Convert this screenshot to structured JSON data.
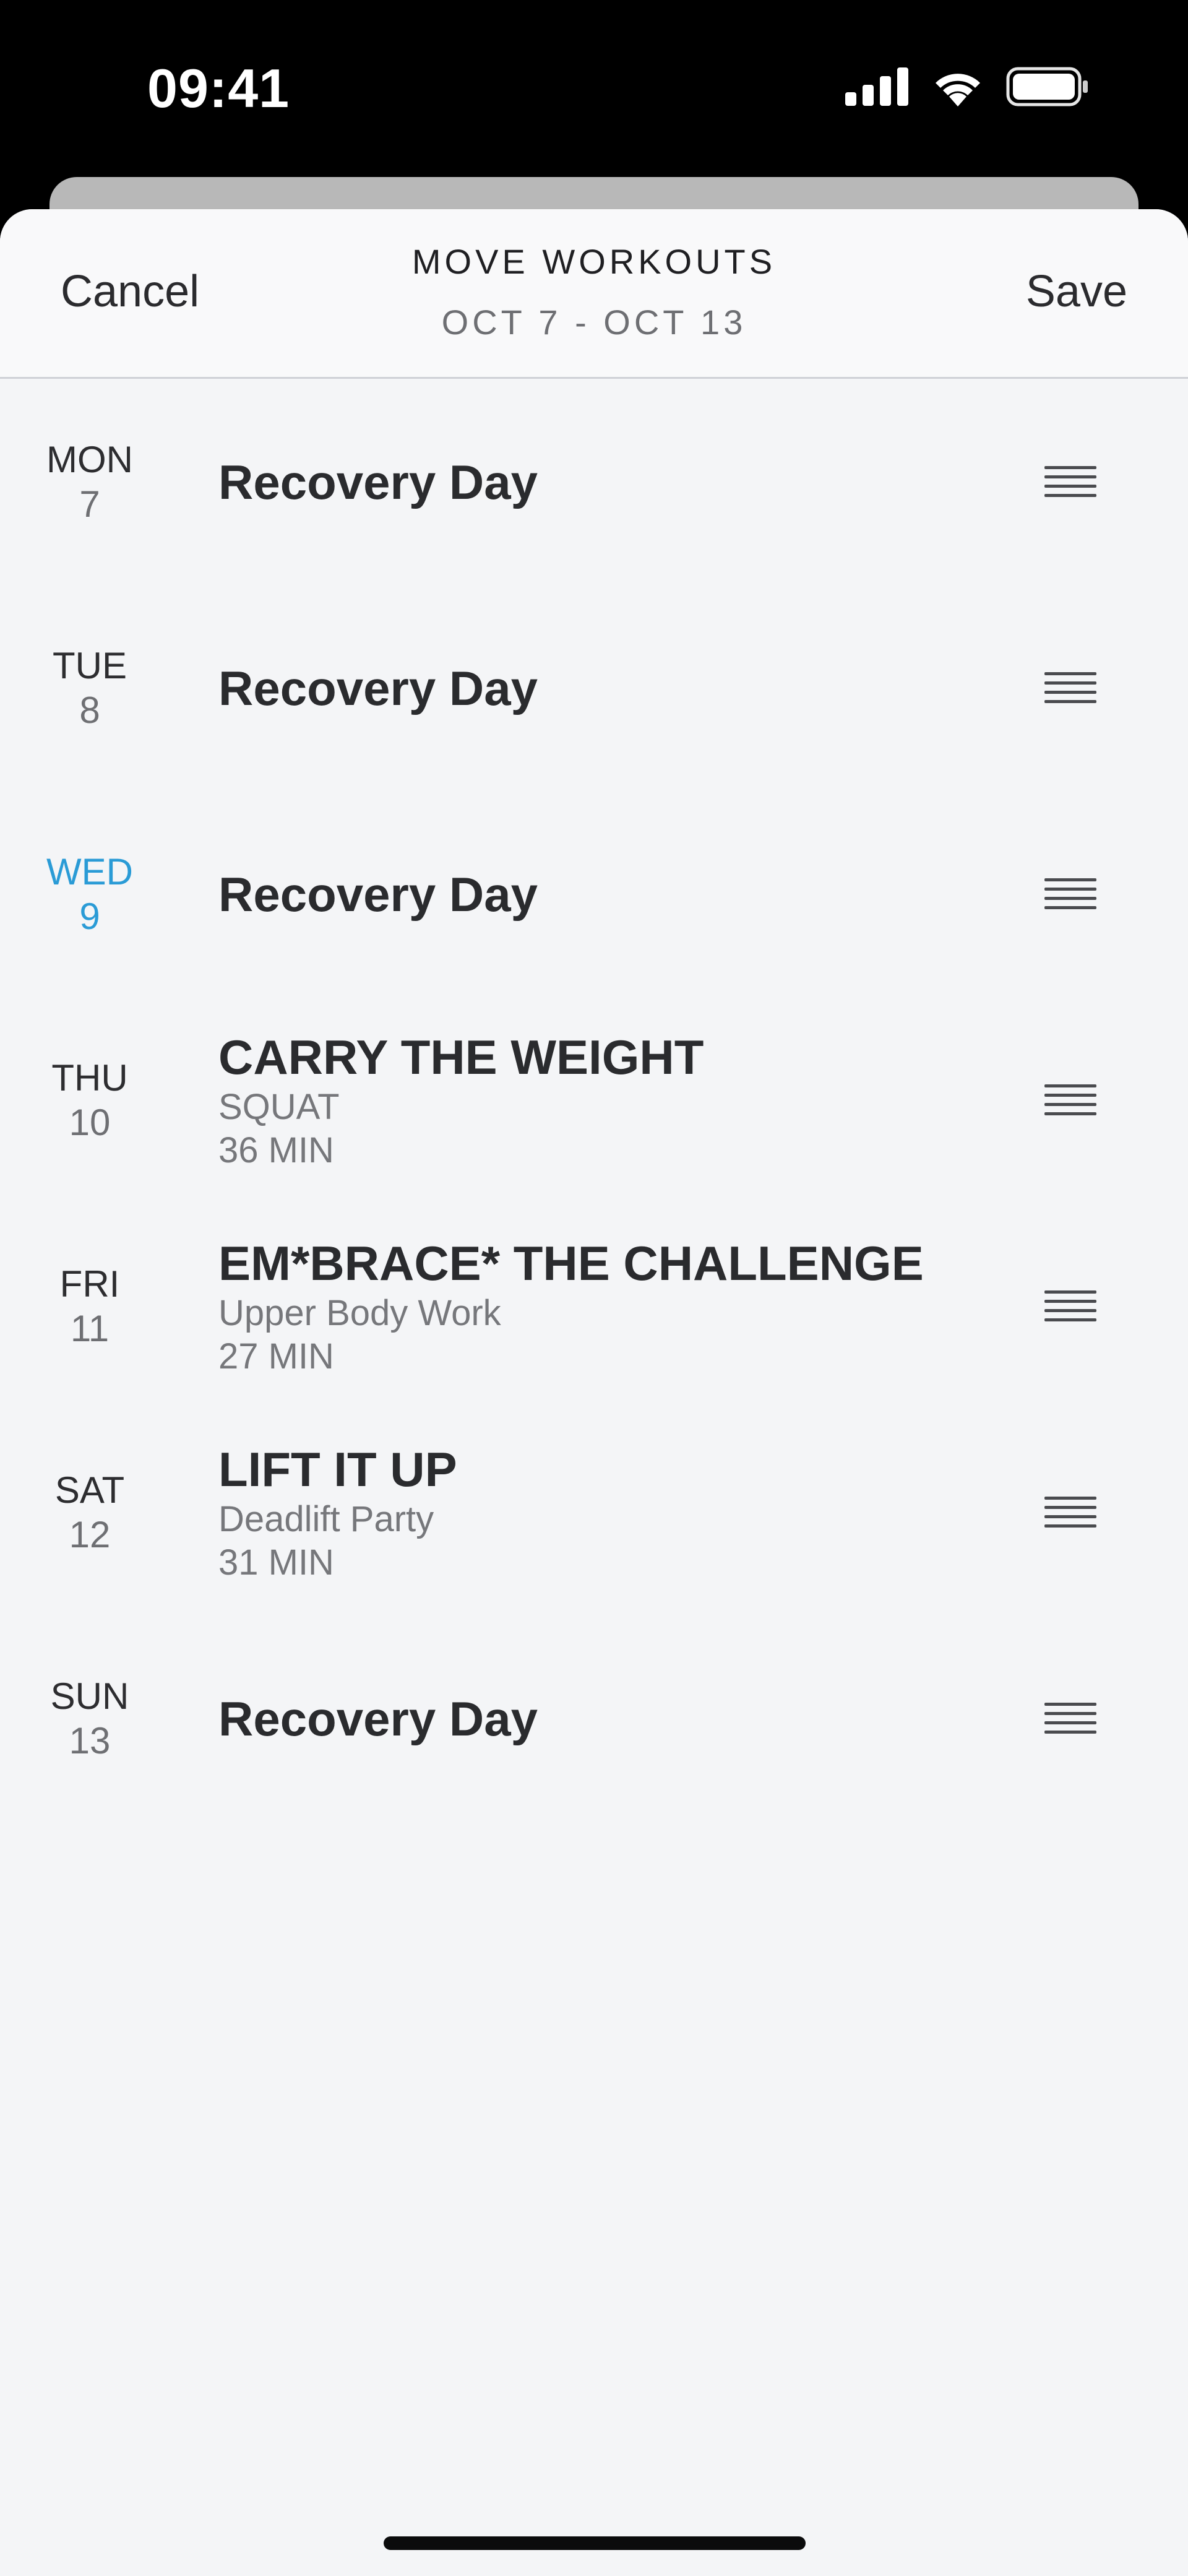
{
  "status_bar": {
    "time": "09:41"
  },
  "header": {
    "cancel_label": "Cancel",
    "title": "MOVE WORKOUTS",
    "subtitle": "OCT 7 - OCT 13",
    "save_label": "Save"
  },
  "days": [
    {
      "day": "MON",
      "date": "7",
      "title": "Recovery Day",
      "subtitle": "",
      "duration": "",
      "today": false
    },
    {
      "day": "TUE",
      "date": "8",
      "title": "Recovery Day",
      "subtitle": "",
      "duration": "",
      "today": false
    },
    {
      "day": "WED",
      "date": "9",
      "title": "Recovery Day",
      "subtitle": "",
      "duration": "",
      "today": true
    },
    {
      "day": "THU",
      "date": "10",
      "title": "CARRY THE WEIGHT",
      "subtitle": "SQUAT",
      "duration": "36 MIN",
      "today": false
    },
    {
      "day": "FRI",
      "date": "11",
      "title": "EM*BRACE* THE CHALLENGE",
      "subtitle": "Upper Body Work",
      "duration": "27 MIN",
      "today": false
    },
    {
      "day": "SAT",
      "date": "12",
      "title": "LIFT IT UP",
      "subtitle": "Deadlift Party",
      "duration": "31 MIN",
      "today": false
    },
    {
      "day": "SUN",
      "date": "13",
      "title": "Recovery Day",
      "subtitle": "",
      "duration": "",
      "today": false
    }
  ],
  "icons": {
    "signal": "cellular-signal-icon",
    "wifi": "wifi-icon",
    "battery": "battery-icon",
    "drag": "drag-handle-icon"
  },
  "colors": {
    "accent_today": "#2a9bd6",
    "sheet_background": "#f4f5f7",
    "header_background": "#f9f9fa"
  }
}
